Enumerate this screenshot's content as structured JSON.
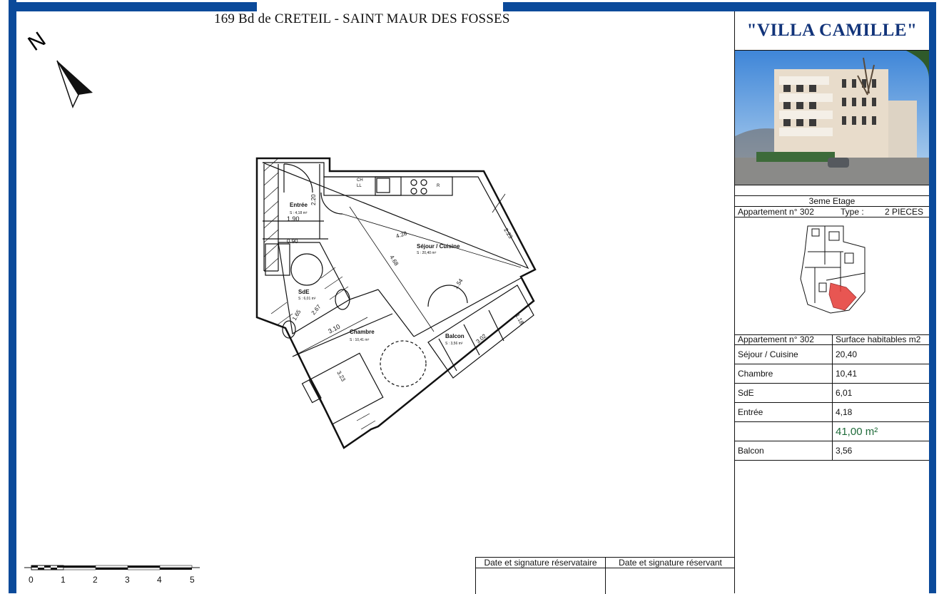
{
  "header": {
    "address": "169 Bd de CRETEIL - SAINT MAUR DES FOSSES"
  },
  "compass": {
    "letter": "N"
  },
  "residence": {
    "name": "\"VILLA CAMILLE\""
  },
  "apartment": {
    "floor": "3eme Etage",
    "number_label": "Appartement n° 302",
    "type_label": "Type :",
    "type_value": "2 PIECES"
  },
  "surfaces": {
    "header_left": "Appartement n° 302",
    "header_right": "Surface habitables m2",
    "rows": [
      {
        "room": "Séjour / Cuisine",
        "value": "20,40"
      },
      {
        "room": "Chambre",
        "value": "10,41"
      },
      {
        "room": "SdE",
        "value": "6,01"
      },
      {
        "room": "Entrée",
        "value": "4,18"
      }
    ],
    "total": "41,00 m²",
    "balcony": {
      "room": "Balcon",
      "value": "3,56"
    }
  },
  "plan": {
    "rooms": {
      "entree": "Entrée",
      "entree_area": "S : 4,18 m²",
      "sejour": "Séjour / Cuisine",
      "sejour_area": "S : 20,40 m²",
      "sde": "SdE",
      "sde_area": "S : 6,01 m²",
      "chambre": "Chambre",
      "chambre_area": "S : 10,41 m²",
      "balcon": "Balcon",
      "balcon_area": "S : 3,56 m²"
    },
    "fixtures": {
      "ch": "CH",
      "ll": "LL",
      "r": "R"
    },
    "dims": [
      "2.20",
      "1.90",
      "0.90",
      "4.28",
      "4.68",
      "2.23",
      "1.54",
      "2.67",
      "1.65",
      "3.10",
      "3.23",
      "3.02",
      "1.18"
    ]
  },
  "scale": {
    "labels": [
      "0",
      "1",
      "2",
      "3",
      "4",
      "5"
    ]
  },
  "signatures": {
    "reservataire": "Date et signature réservataire",
    "reservant": "Date et signature réservant"
  },
  "colors": {
    "frame": "#0b4a9a",
    "title": "#12347a",
    "highlight": "#e53935"
  }
}
